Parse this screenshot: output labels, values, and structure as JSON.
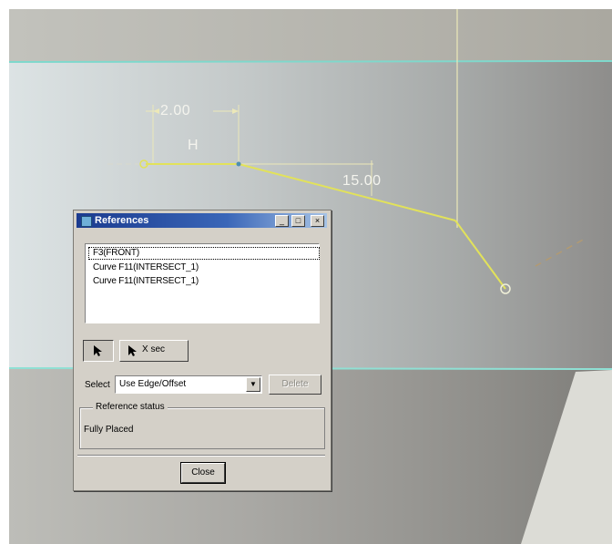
{
  "sketch": {
    "dim_horizontal": "2.00",
    "constraint_h": "H",
    "dim_angle": "15.00",
    "colors": {
      "sketch": "#e2e25a",
      "guide": "#ece8b8",
      "edge": "#7fd8cc",
      "dim_text": "#f4f4ee"
    }
  },
  "dialog": {
    "title": "References",
    "window_buttons": {
      "minimize": "_",
      "restore": "□",
      "close": "×"
    },
    "references": [
      "F3(FRONT)",
      "Curve F11(INTERSECT_1)",
      "Curve F11(INTERSECT_1)"
    ],
    "tools": {
      "xsec_label": "X sec"
    },
    "select": {
      "label": "Select",
      "value": "Use Edge/Offset"
    },
    "delete_label": "Delete",
    "status": {
      "title": "Reference status",
      "text": "Fully Placed"
    },
    "close_label": "Close",
    "colors": {
      "face": "#d4d0c8",
      "title_start": "#1b3b8f",
      "title_end": "#a6c3e6"
    }
  }
}
